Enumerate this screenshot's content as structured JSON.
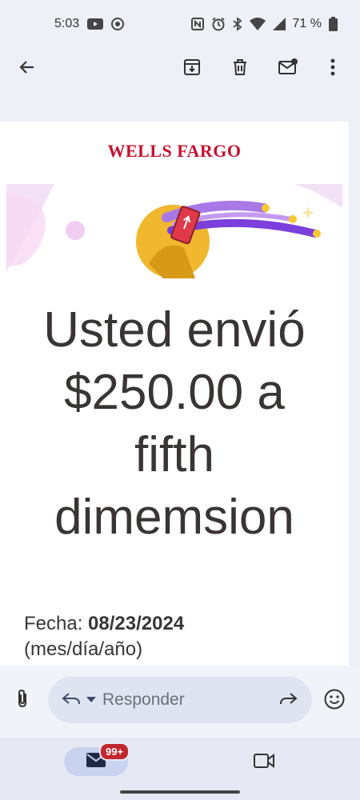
{
  "status_bar": {
    "time": "5:03",
    "battery": "71 %"
  },
  "toolbar": {
    "icons": [
      "back-arrow-icon",
      "archive-icon",
      "delete-icon",
      "mark-unread-icon",
      "more-vert-icon"
    ]
  },
  "email": {
    "brand": "WELLS FARGO",
    "headline": [
      "Usted envió",
      "$250.00 a",
      "fifth",
      "dimemsion"
    ],
    "date_label": "Fecha: ",
    "date_value": "08/23/2024",
    "date_format": "(mes/día/año)"
  },
  "reply": {
    "placeholder": "Responder"
  },
  "bottom_nav": {
    "mail_badge": "99+"
  },
  "colors": {
    "brand_red": "#c8102e",
    "accent_purple": "#8a4fe0",
    "badge_red": "#c1272d"
  }
}
